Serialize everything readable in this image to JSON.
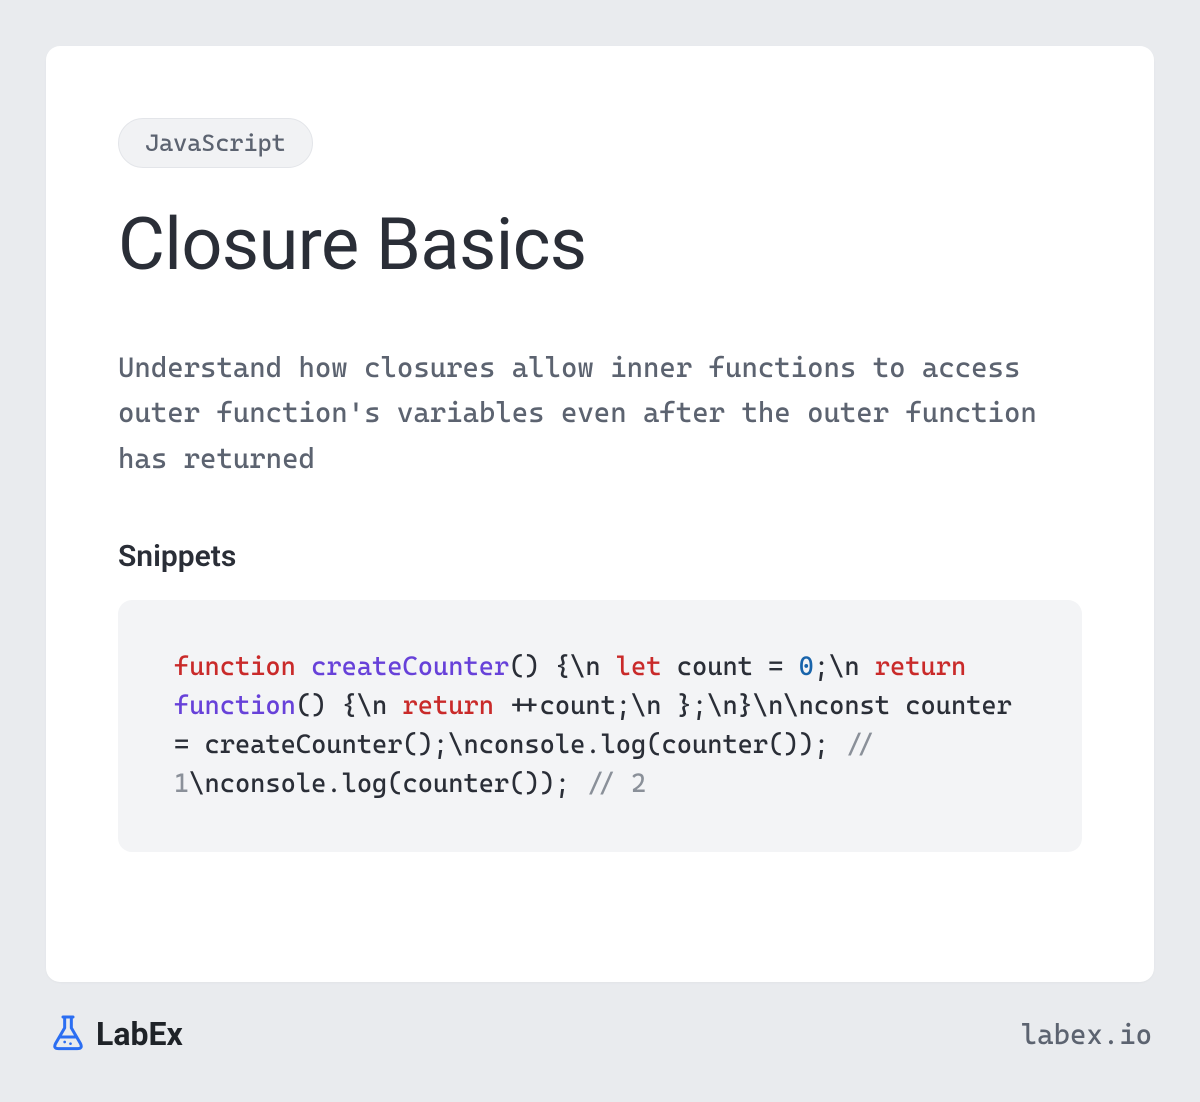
{
  "card": {
    "badge": "JavaScript",
    "title": "Closure Basics",
    "description": "Understand how closures allow inner functions to access outer function's variables even after the outer function has returned",
    "snippets_heading": "Snippets",
    "code_tokens": [
      {
        "text": "function",
        "cls": "tok-kw"
      },
      {
        "text": " "
      },
      {
        "text": "createCounter",
        "cls": "tok-fn"
      },
      {
        "text": "() {\\n  "
      },
      {
        "text": "let",
        "cls": "tok-kw"
      },
      {
        "text": " count = "
      },
      {
        "text": "0",
        "cls": "tok-num"
      },
      {
        "text": ";\\n  "
      },
      {
        "text": "return",
        "cls": "tok-kw"
      },
      {
        "text": " "
      },
      {
        "text": "function",
        "cls": "tok-fn"
      },
      {
        "text": "() {\\n    "
      },
      {
        "text": "return",
        "cls": "tok-kw"
      },
      {
        "text": " ++count;\\n  };\\n}\\n\\nconst counter = createCounter();\\nconsole.log(counter()); "
      },
      {
        "text": "// 1",
        "cls": "tok-comment"
      },
      {
        "text": "\\nconsole.log(counter()); "
      },
      {
        "text": "// 2",
        "cls": "tok-comment"
      }
    ]
  },
  "footer": {
    "brand": "LabEx",
    "url": "labex.io"
  }
}
